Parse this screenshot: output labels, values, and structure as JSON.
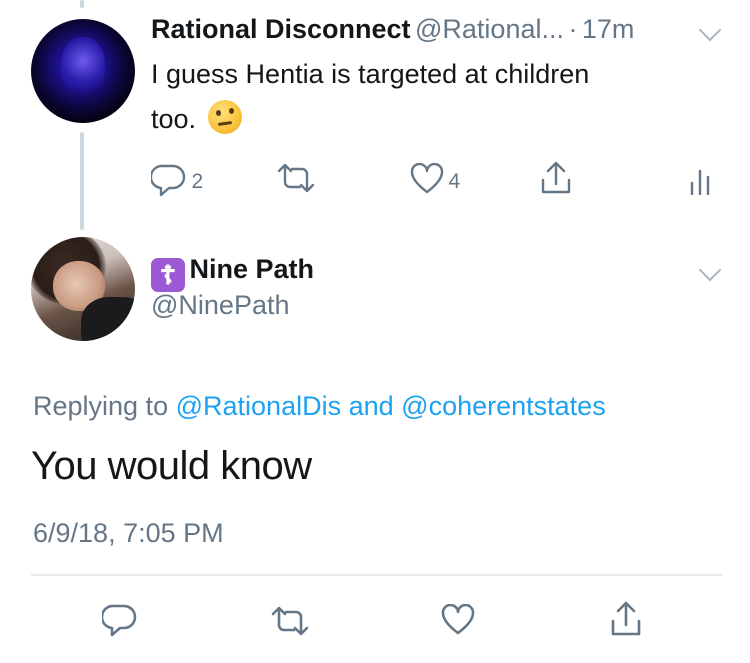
{
  "parent_tweet": {
    "author_name": "Rational Disconnect",
    "author_handle": "@Rational...",
    "separator": "·",
    "timestamp": "17m",
    "text_line1": "I guess Hentia is targeted at children",
    "text_line2": "too.",
    "emoji_name": "thinking-face-emoji",
    "replies_count": "2",
    "likes_count": "4"
  },
  "reply_tweet": {
    "cross_symbol": "☦",
    "author_name": "Nine Path",
    "author_handle": "@NinePath",
    "replying_prefix": "Replying to",
    "replying_user1": "@RationalDis",
    "replying_and": "and",
    "replying_user2": "@coherentstates",
    "text": "You would know",
    "timestamp": "6/9/18, 7:05 PM"
  },
  "icons": {
    "reply": "reply-icon",
    "retweet": "retweet-icon",
    "like": "heart-icon",
    "share": "share-icon",
    "analytics": "analytics-icon",
    "caret": "chevron-down-icon"
  },
  "colors": {
    "link": "#1da1f2",
    "muted": "#657786",
    "text": "#14171a",
    "cross_badge": "#9b59d6"
  }
}
